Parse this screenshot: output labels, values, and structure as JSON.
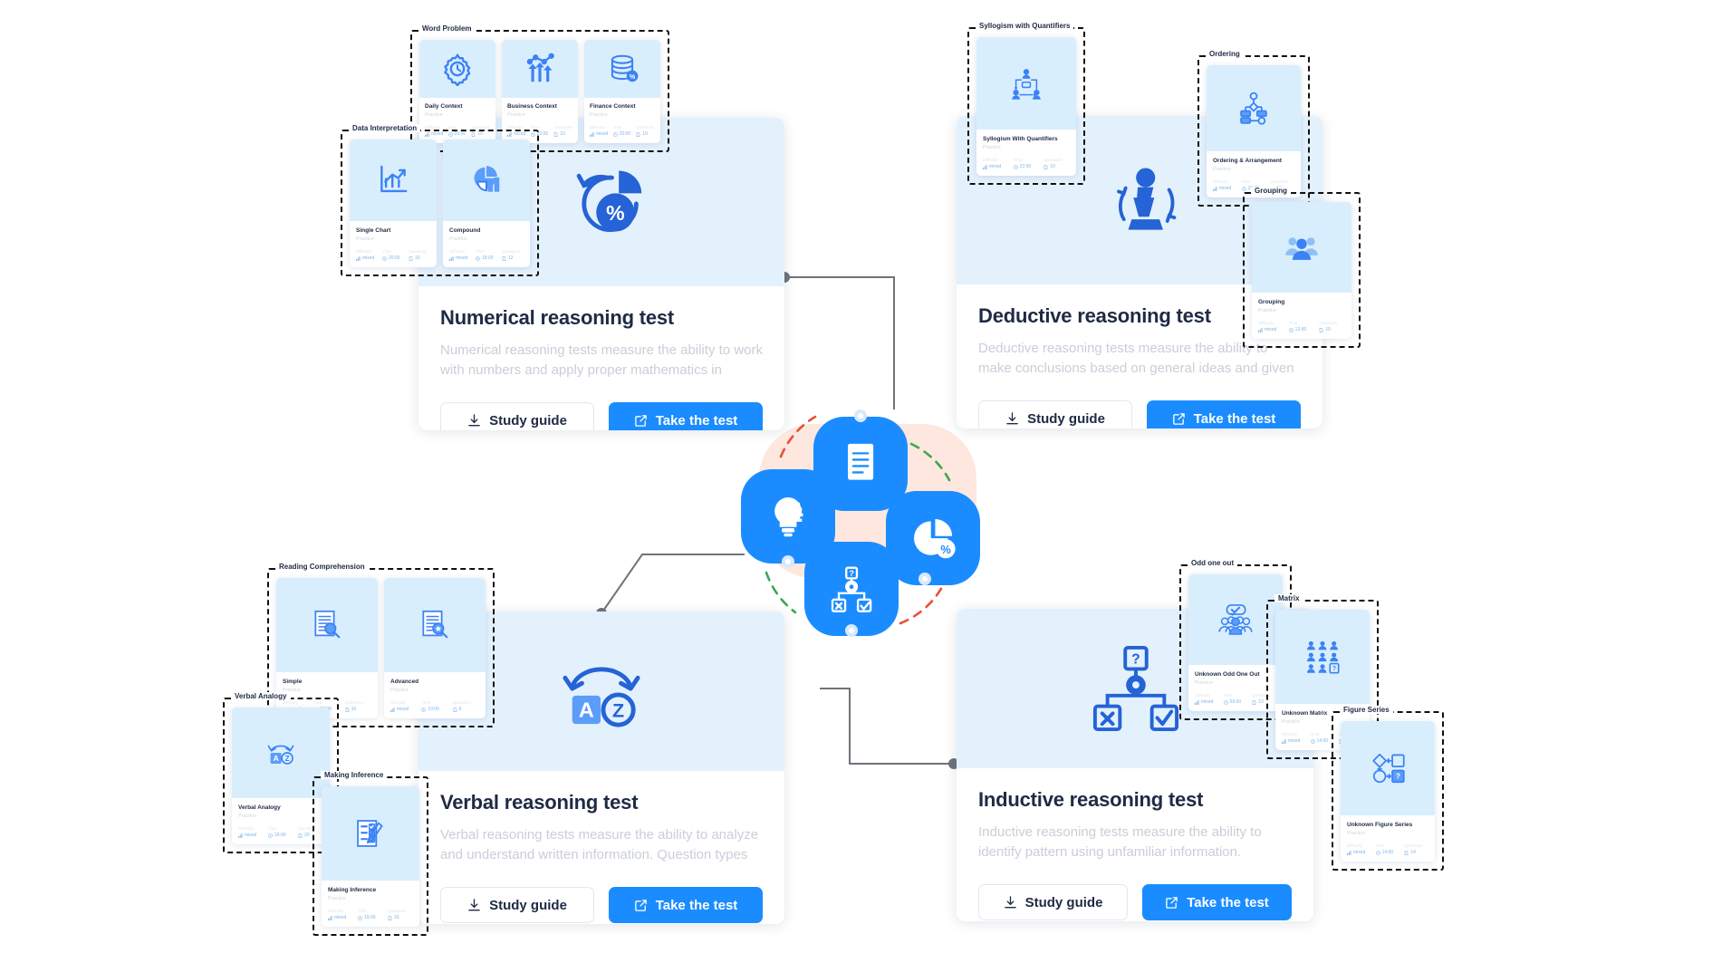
{
  "meta": {
    "accent": "#1a8cff",
    "hero_bg": "#e3f1fd",
    "mini_hero_bg": "#d9eefc",
    "blob": "#fde7de"
  },
  "buttons": {
    "study_guide": "Study guide",
    "take_the_test": "Take the test"
  },
  "meta_labels": {
    "difficulty": "Difficulty",
    "time": "Time",
    "questions": "Questions",
    "practice": "Practice"
  },
  "tests": [
    {
      "id": "numerical",
      "title": "Numerical reasoning test",
      "description": "Numerical reasoning tests measure the ability to work with numbers and apply proper mathematics in various situations,...",
      "hero_icon": "pie-percent-icon"
    },
    {
      "id": "deductive",
      "title": "Deductive reasoning test",
      "description": "Deductive reasoning tests measure the ability to make conclusions based on general ideas and given statements...",
      "hero_icon": "chess-pawn-icon"
    },
    {
      "id": "verbal",
      "title": "Verbal reasoning test",
      "description": "Verbal reasoning tests measure the ability to analyze and understand written information. Question types include Verba...",
      "hero_icon": "az-analogy-icon"
    },
    {
      "id": "inductive",
      "title": "Inductive reasoning test",
      "description": "Inductive reasoning tests measure the ability to identify pattern using unfamiliar information. Question types include Figure...",
      "hero_icon": "flow-gear-icon"
    }
  ],
  "groups": [
    {
      "id": "word-problem",
      "label": "Word Problem",
      "cards": [
        {
          "title": "Daily Context",
          "sub": "Practice",
          "icon": "gear-clock-icon",
          "difficulty": "mixed",
          "time": "20:00",
          "questions": "10"
        },
        {
          "title": "Business Context",
          "sub": "Practice",
          "icon": "growth-arrows-icon",
          "difficulty": "mixed",
          "time": "20:00",
          "questions": "10"
        },
        {
          "title": "Finance Context",
          "sub": "Practice",
          "icon": "database-percent-icon",
          "difficulty": "mixed",
          "time": "20:00",
          "questions": "10"
        }
      ]
    },
    {
      "id": "data-interpretation",
      "label": "Data Interpretation",
      "cards": [
        {
          "title": "Single Chart",
          "sub": "Practice",
          "icon": "bar-chart-arrow-icon",
          "difficulty": "mixed",
          "time": "20:00",
          "questions": "10"
        },
        {
          "title": "Compound",
          "sub": "Practice",
          "icon": "pie-bar-icon",
          "difficulty": "mixed",
          "time": "18:00",
          "questions": "12"
        }
      ]
    },
    {
      "id": "syllogism",
      "label": "Syllogism with Quantifiers",
      "cards": [
        {
          "title": "Syllogism With Quantifiers",
          "sub": "Practice",
          "icon": "syllogism-nodes-icon",
          "difficulty": "mixed",
          "time": "22:00",
          "questions": "10"
        }
      ]
    },
    {
      "id": "ordering",
      "label": "Ordering",
      "cards": [
        {
          "title": "Ordering & Arrangement",
          "sub": "Practice",
          "icon": "flowchart-icon",
          "difficulty": "mixed",
          "time": "20:00",
          "questions": "10"
        }
      ]
    },
    {
      "id": "grouping",
      "label": "Grouping",
      "cards": [
        {
          "title": "Grouping",
          "sub": "Practice",
          "icon": "people-group-icon",
          "difficulty": "mixed",
          "time": "12:00",
          "questions": "10"
        }
      ]
    },
    {
      "id": "reading-comprehension",
      "label": "Reading Comprehension",
      "cards": [
        {
          "title": "Simple",
          "sub": "Practice",
          "icon": "document-search-icon",
          "difficulty": "mixed",
          "time": "10:00",
          "questions": "10"
        },
        {
          "title": "Advanced",
          "sub": "Practice",
          "icon": "document-search-star-icon",
          "difficulty": "mixed",
          "time": "10:00",
          "questions": "6"
        }
      ]
    },
    {
      "id": "verbal-analogy",
      "label": "Verbal Analogy",
      "cards": [
        {
          "title": "Verbal Analogy",
          "sub": "Practice",
          "icon": "az-analogy-icon",
          "difficulty": "mixed",
          "time": "18:00",
          "questions": "20"
        }
      ]
    },
    {
      "id": "making-inference",
      "label": "Making Inference",
      "cards": [
        {
          "title": "Making Inference",
          "sub": "Practice",
          "icon": "checklist-pen-icon",
          "difficulty": "mixed",
          "time": "19:00",
          "questions": "20"
        }
      ]
    },
    {
      "id": "odd-one-out",
      "label": "Odd one out",
      "cards": [
        {
          "title": "Unknown Odd One Out",
          "sub": "Practice",
          "icon": "people-check-icon",
          "difficulty": "mixed",
          "time": "56:00",
          "questions": "12"
        }
      ]
    },
    {
      "id": "matrix",
      "label": "Matrix",
      "cards": [
        {
          "title": "Unknown Matrix",
          "sub": "Practice",
          "icon": "matrix-people-icon",
          "difficulty": "mixed",
          "time": "14:00",
          "questions": "14"
        }
      ]
    },
    {
      "id": "figure-series",
      "label": "Figure Series",
      "cards": [
        {
          "title": "Unknown Figure Series",
          "sub": "Practice",
          "icon": "figure-series-icon",
          "difficulty": "mixed",
          "time": "14:00",
          "questions": "14"
        }
      ]
    }
  ],
  "hub": {
    "tiles": [
      {
        "id": "document",
        "icon": "document-icon"
      },
      {
        "id": "idea",
        "icon": "lightbulb-gear-icon"
      },
      {
        "id": "pie",
        "icon": "pie-percent-icon"
      },
      {
        "id": "flow",
        "icon": "flow-decision-icon"
      }
    ]
  }
}
